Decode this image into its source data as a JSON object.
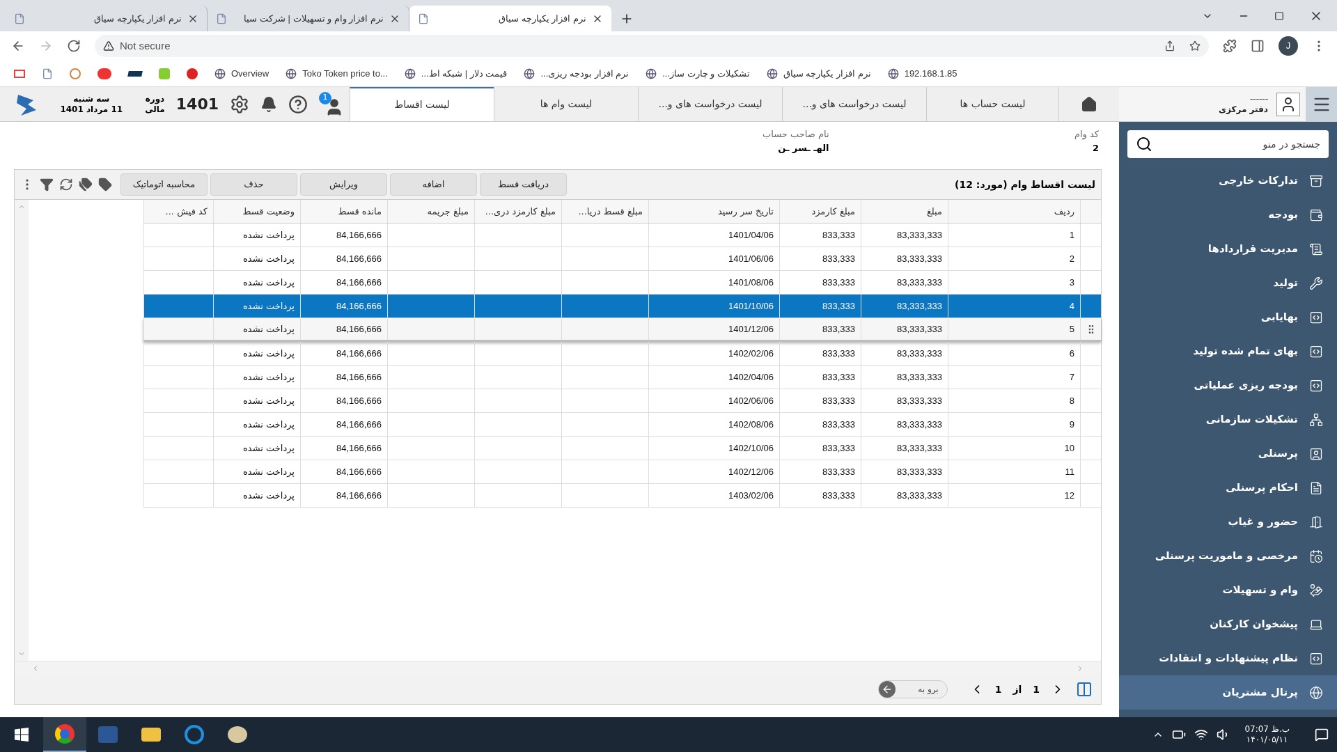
{
  "browser": {
    "tabs": [
      {
        "title": "نرم افزار یکپارچه سیاق",
        "selected": true
      },
      {
        "title": "نرم افزار وام و تسهیلات | شرکت سیا",
        "selected": false
      },
      {
        "title": "نرم افزار یکپارچه سیاق",
        "selected": false
      }
    ],
    "address": {
      "warning": "Not secure"
    },
    "bookmarks": [
      {
        "label": "192.168.1.85"
      },
      {
        "label": "نرم افزار یکپارچه سیاق"
      },
      {
        "label": "تشکیلات و چارت ساز..."
      },
      {
        "label": "نرم افزار بودجه ریزی..."
      },
      {
        "label": "قیمت دلار | شبکه اط..."
      },
      {
        "label": "Toko Token price to..."
      },
      {
        "label": "Overview"
      }
    ],
    "profile": "J"
  },
  "header": {
    "user": {
      "name": "------",
      "office": "دفتر مرکزی"
    },
    "tabs": [
      {
        "label": "لیست حساب ها",
        "selected": false
      },
      {
        "label": "لیست درخواست های و...",
        "selected": false
      },
      {
        "label": "لیست درخواست های و...",
        "selected": false
      },
      {
        "label": "لیست وام ها",
        "selected": false
      },
      {
        "label": "لیست اقساط",
        "selected": true
      }
    ],
    "notifications": "1",
    "year": "1401",
    "period_label": [
      "دوره",
      "مالی"
    ],
    "day": "سه شنبه",
    "date": "11 مرداد 1401"
  },
  "sidebar": {
    "search": {
      "placeholder": "جستجو در منو"
    },
    "items": [
      {
        "label": "تدارکات خارجی",
        "selected": false
      },
      {
        "label": "بودجه",
        "selected": false
      },
      {
        "label": "مدیریت قراردادها",
        "selected": false
      },
      {
        "label": "تولید",
        "selected": false
      },
      {
        "label": "بهایابی",
        "selected": false
      },
      {
        "label": "بهای تمام شده تولید",
        "selected": false
      },
      {
        "label": "بودجه ریزی عملیاتی",
        "selected": false
      },
      {
        "label": "تشکیلات سازمانی",
        "selected": false
      },
      {
        "label": "پرسنلی",
        "selected": false
      },
      {
        "label": "احکام پرسنلی",
        "selected": false
      },
      {
        "label": "حضور و غیاب",
        "selected": false
      },
      {
        "label": "مرخصی و ماموریت پرسنلی",
        "selected": false
      },
      {
        "label": "وام و تسهیلات",
        "selected": false
      },
      {
        "label": "پیشخوان کارکنان",
        "selected": false
      },
      {
        "label": "نظام پیشنهادات و انتقادات",
        "selected": false
      },
      {
        "label": "پرتال مشتریان",
        "selected": true
      }
    ]
  },
  "info": {
    "loan_code_label": "کد وام",
    "loan_code": "2",
    "owner_label": "نام صاحب حساب",
    "owner": "الهـ ـسر ـن"
  },
  "panel": {
    "title": "لیست اقساط وام (مورد: 12)",
    "buttons": [
      "دریافت قسط",
      "اضافه",
      "ویرایش",
      "حذف",
      "محاسبه اتوماتیک"
    ]
  },
  "table": {
    "columns": [
      "ردیف",
      "مبلغ",
      "مبلغ کارمزد",
      "تاریخ سر رسید",
      "مبلغ قسط دریا...",
      "مبلغ کارمزد دری...",
      "مبلغ جریمه",
      "مانده قسط",
      "وضعیت قسط",
      "کد فیش ..."
    ],
    "rows": [
      {
        "number": "1",
        "amount": "83,333,333",
        "fee": "833,333",
        "due_date": "1401/04/06",
        "remaining": "84,166,666",
        "status": "پرداخت نشده",
        "selected": false,
        "hovered": false
      },
      {
        "number": "2",
        "amount": "83,333,333",
        "fee": "833,333",
        "due_date": "1401/06/06",
        "remaining": "84,166,666",
        "status": "پرداخت نشده",
        "selected": false,
        "hovered": false
      },
      {
        "number": "3",
        "amount": "83,333,333",
        "fee": "833,333",
        "due_date": "1401/08/06",
        "remaining": "84,166,666",
        "status": "پرداخت نشده",
        "selected": false,
        "hovered": false
      },
      {
        "number": "4",
        "amount": "83,333,333",
        "fee": "833,333",
        "due_date": "1401/10/06",
        "remaining": "84,166,666",
        "status": "پرداخت نشده",
        "selected": true,
        "hovered": false
      },
      {
        "number": "5",
        "amount": "83,333,333",
        "fee": "833,333",
        "due_date": "1401/12/06",
        "remaining": "84,166,666",
        "status": "پرداخت نشده",
        "selected": false,
        "hovered": true
      },
      {
        "number": "6",
        "amount": "83,333,333",
        "fee": "833,333",
        "due_date": "1402/02/06",
        "remaining": "84,166,666",
        "status": "پرداخت نشده",
        "selected": false,
        "hovered": false
      },
      {
        "number": "7",
        "amount": "83,333,333",
        "fee": "833,333",
        "due_date": "1402/04/06",
        "remaining": "84,166,666",
        "status": "پرداخت نشده",
        "selected": false,
        "hovered": false
      },
      {
        "number": "8",
        "amount": "83,333,333",
        "fee": "833,333",
        "due_date": "1402/06/06",
        "remaining": "84,166,666",
        "status": "پرداخت نشده",
        "selected": false,
        "hovered": false
      },
      {
        "number": "9",
        "amount": "83,333,333",
        "fee": "833,333",
        "due_date": "1402/08/06",
        "remaining": "84,166,666",
        "status": "پرداخت نشده",
        "selected": false,
        "hovered": false
      },
      {
        "number": "10",
        "amount": "83,333,333",
        "fee": "833,333",
        "due_date": "1402/10/06",
        "remaining": "84,166,666",
        "status": "پرداخت نشده",
        "selected": false,
        "hovered": false
      },
      {
        "number": "11",
        "amount": "83,333,333",
        "fee": "833,333",
        "due_date": "1402/12/06",
        "remaining": "84,166,666",
        "status": "پرداخت نشده",
        "selected": false,
        "hovered": false
      },
      {
        "number": "12",
        "amount": "83,333,333",
        "fee": "833,333",
        "due_date": "1403/02/06",
        "remaining": "84,166,666",
        "status": "پرداخت نشده",
        "selected": false,
        "hovered": false
      }
    ]
  },
  "pagination": {
    "page": "1",
    "of": "از",
    "total": "1",
    "goto": {
      "placeholder": "برو به"
    }
  },
  "taskbar": {
    "time": "ب.ظ 07:07",
    "date": "۱۴۰۱/۰۵/۱۱"
  }
}
